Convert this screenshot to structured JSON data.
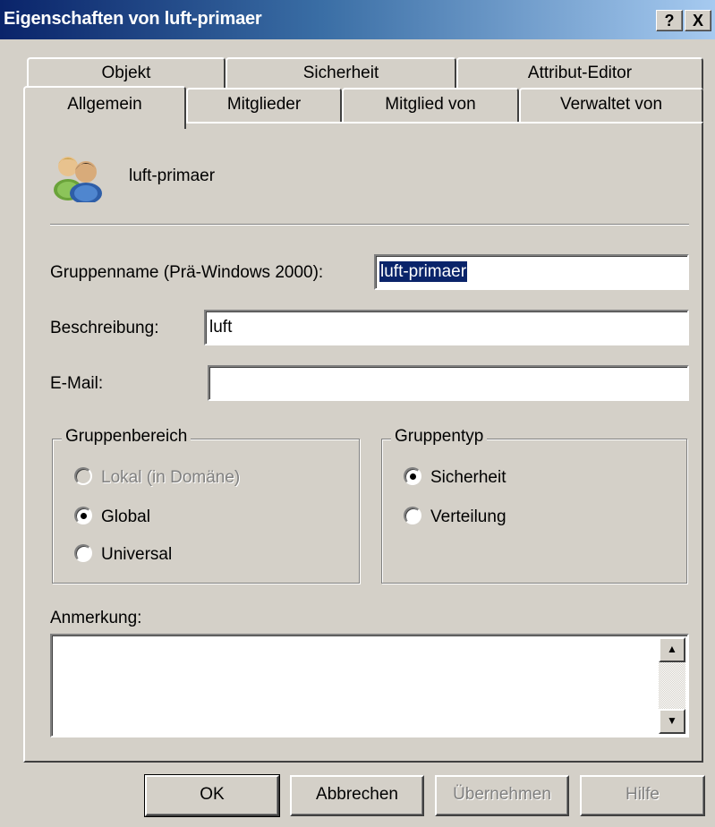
{
  "window": {
    "title": "Eigenschaften von luft-primaer",
    "help_button": "?",
    "close_button": "X"
  },
  "tabs": {
    "back_row": [
      {
        "label": "Objekt"
      },
      {
        "label": "Sicherheit"
      },
      {
        "label": "Attribut-Editor"
      }
    ],
    "front_row": [
      {
        "label": "Allgemein",
        "active": true
      },
      {
        "label": "Mitglieder"
      },
      {
        "label": "Mitglied von"
      },
      {
        "label": "Verwaltet von"
      }
    ]
  },
  "general": {
    "group_display_name": "luft-primaer",
    "icon": "users-group-icon",
    "pre2000_label": "Gruppenname (Prä-Windows 2000):",
    "pre2000_value": "luft-primaer",
    "description_label": "Beschreibung:",
    "description_value": "luft",
    "email_label": "E-Mail:",
    "email_value": "",
    "scope": {
      "legend": "Gruppenbereich",
      "options": [
        {
          "label": "Lokal (in Domäne)",
          "checked": false,
          "disabled": true
        },
        {
          "label": "Global",
          "checked": true,
          "disabled": false
        },
        {
          "label": "Universal",
          "checked": false,
          "disabled": false
        }
      ]
    },
    "type": {
      "legend": "Gruppentyp",
      "options": [
        {
          "label": "Sicherheit",
          "checked": true
        },
        {
          "label": "Verteilung",
          "checked": false
        }
      ]
    },
    "notes_label": "Anmerkung:",
    "notes_value": ""
  },
  "buttons": {
    "ok": "OK",
    "cancel": "Abbrechen",
    "apply": "Übernehmen",
    "help": "Hilfe"
  }
}
